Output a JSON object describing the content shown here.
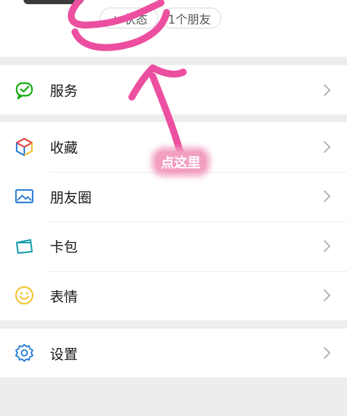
{
  "header": {
    "status_button": {
      "icon": "plus-icon",
      "label": "+ 状态"
    },
    "friends_button": {
      "label": "1个朋友"
    }
  },
  "menu": {
    "services": {
      "label": "服务",
      "icon": "wechat-pay-icon"
    },
    "favorites": {
      "label": "收藏",
      "icon": "cube-icon"
    },
    "moments": {
      "label": "朋友圈",
      "icon": "image-icon"
    },
    "cards": {
      "label": "卡包",
      "icon": "card-icon"
    },
    "stickers": {
      "label": "表情",
      "icon": "smiley-icon"
    },
    "settings": {
      "label": "设置",
      "icon": "gear-icon"
    }
  },
  "annotation": {
    "text": "点这里",
    "color": "#ec4fa0"
  },
  "colors": {
    "page_bg": "#ededed",
    "services_icon": "#1aad19",
    "image_icon": "#2a7ed6",
    "card_icon": "#1a9fb0",
    "smiley_icon": "#f2c230",
    "gear_icon": "#2a7ed6"
  }
}
